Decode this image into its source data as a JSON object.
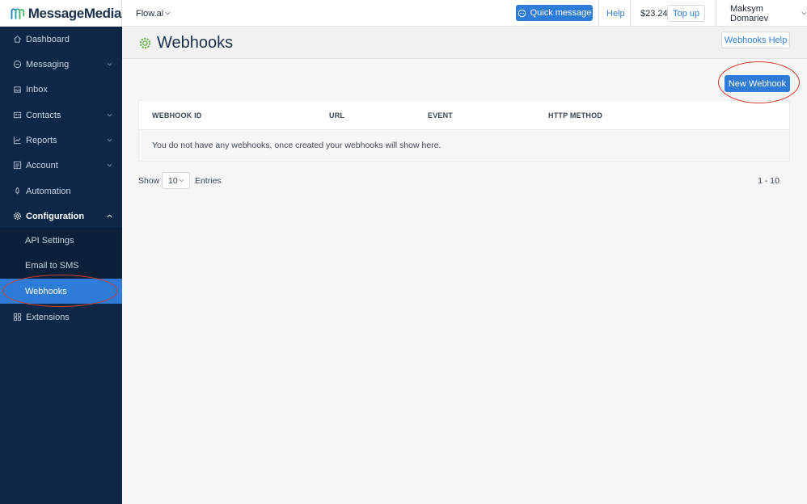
{
  "brand": {
    "name": "MessageMedia"
  },
  "topbar": {
    "account": "Flow.ai",
    "quick_message": "Quick message",
    "help": "Help",
    "balance": "$23.24",
    "top_up": "Top up",
    "user": "Maksym Domariev"
  },
  "sidebar": {
    "items": [
      {
        "label": "Dashboard",
        "icon": "home-icon"
      },
      {
        "label": "Messaging",
        "icon": "chat-bubble-icon",
        "expandable": true
      },
      {
        "label": "Inbox",
        "icon": "inbox-icon"
      },
      {
        "label": "Contacts",
        "icon": "contact-card-icon",
        "expandable": true
      },
      {
        "label": "Reports",
        "icon": "line-chart-icon",
        "expandable": true
      },
      {
        "label": "Account",
        "icon": "account-icon",
        "expandable": true
      },
      {
        "label": "Automation",
        "icon": "rocket-icon"
      },
      {
        "label": "Configuration",
        "icon": "gear-icon",
        "expanded": true
      },
      {
        "label": "Extensions",
        "icon": "grid-icon"
      }
    ],
    "subitems": [
      {
        "label": "API Settings"
      },
      {
        "label": "Email to SMS"
      },
      {
        "label": "Webhooks",
        "active": true
      }
    ]
  },
  "page": {
    "title": "Webhooks",
    "help_button": "Webhooks Help",
    "new_button": "New Webhook"
  },
  "table": {
    "columns": [
      "WEBHOOK ID",
      "URL",
      "EVENT",
      "HTTP METHOD"
    ],
    "empty_message": "You do not have any webhooks, once created your webhooks will show here."
  },
  "pagination": {
    "show_label": "Show",
    "page_size": "10",
    "entries_label": "Entries",
    "range": "1 - 10"
  },
  "colors": {
    "accent": "#2f7bd8",
    "sidebar_bg": "#0d2847",
    "highlight_ring": "#d43a2c",
    "title_icon": "#5fae3d"
  }
}
